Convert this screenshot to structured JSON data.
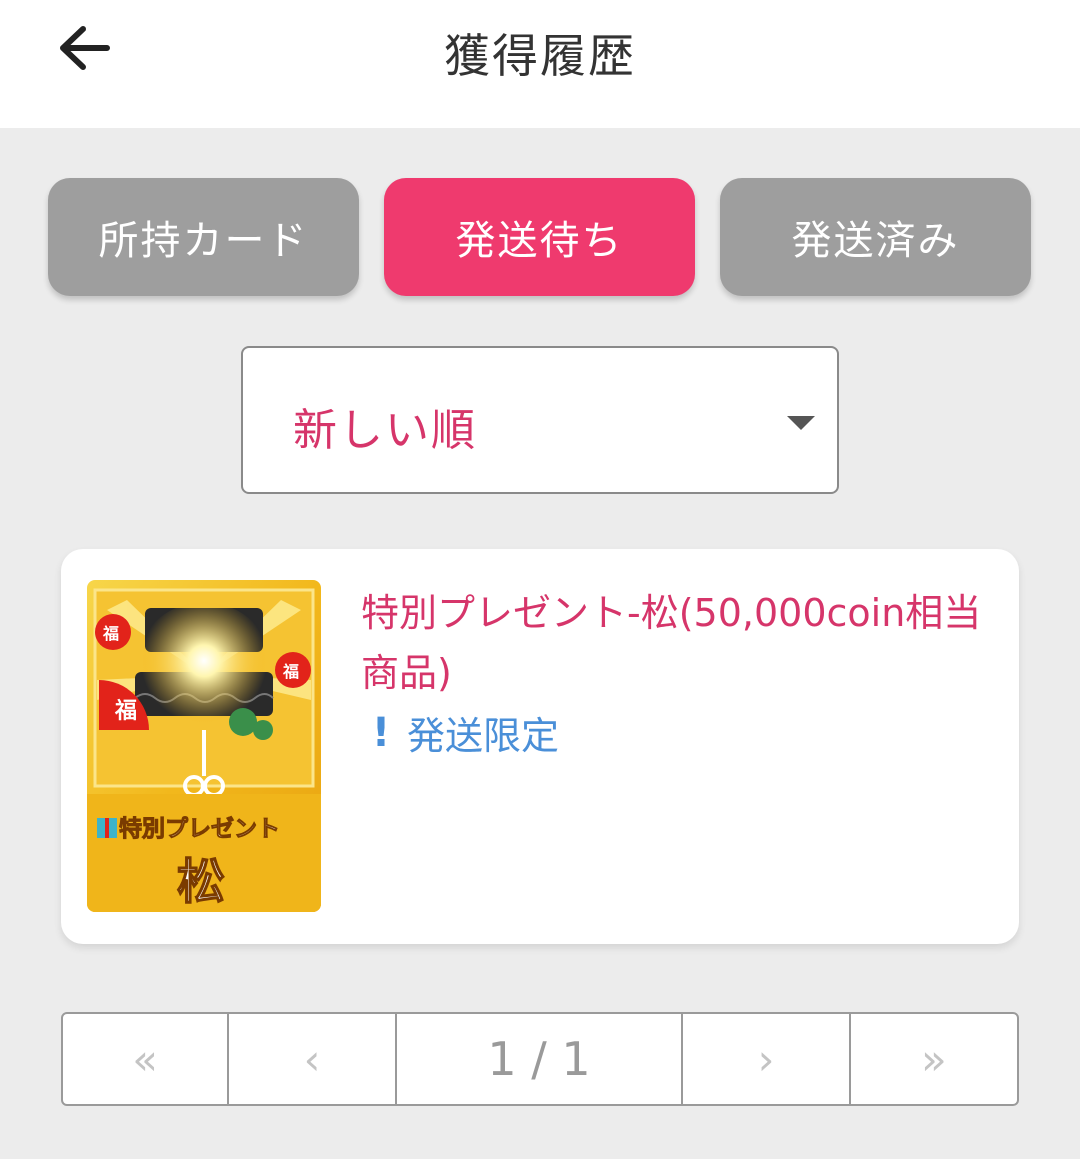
{
  "header": {
    "title": "獲得履歴",
    "back_icon": "arrow-left-icon"
  },
  "tabs": [
    {
      "label": "所持カード",
      "active": false
    },
    {
      "label": "発送待ち",
      "active": true
    },
    {
      "label": "発送済み",
      "active": false
    }
  ],
  "sort": {
    "selected": "新しい順",
    "icon": "caret-down-icon"
  },
  "items": [
    {
      "name": "特別プレゼント-松(50,000coin相当商品)",
      "tag_icon": "!",
      "tag": "発送限定",
      "thumbnail": {
        "banner_text": "特別プレゼント",
        "main_text": "松",
        "fan_text": "福"
      }
    }
  ],
  "pagination": {
    "first": "«",
    "prev": "‹",
    "page": "1 / 1",
    "next": "›",
    "last": "»"
  },
  "colors": {
    "accent": "#ef3a6e",
    "accent_text": "#d6356a",
    "link": "#4a8fd8",
    "inactive_tab": "#9e9e9e"
  }
}
